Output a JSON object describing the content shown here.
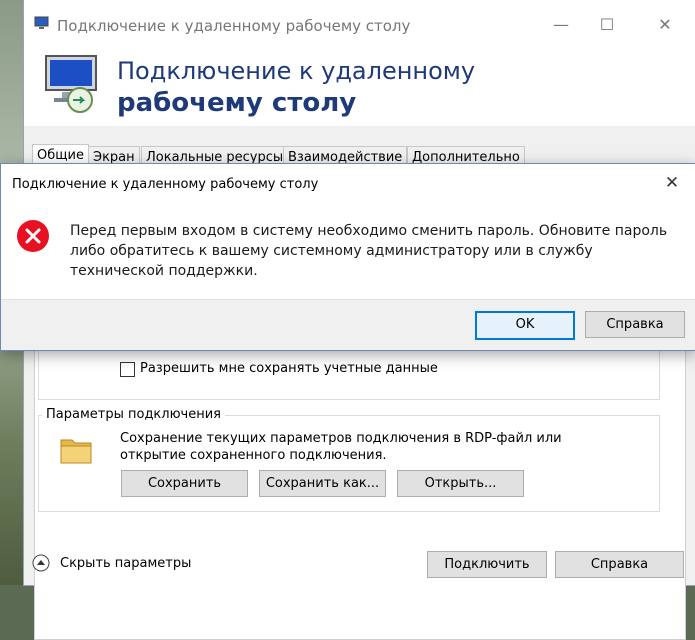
{
  "window": {
    "title": "Подключение к удаленному рабочему столу",
    "banner_line1": "Подключение к удаленному",
    "banner_line2": "рабочему столу"
  },
  "tabs": [
    {
      "label": "Общие",
      "active": true
    },
    {
      "label": "Экран"
    },
    {
      "label": "Локальные ресурсы"
    },
    {
      "label": "Взаимодействие"
    },
    {
      "label": "Дополнительно"
    }
  ],
  "general": {
    "save_credentials_label": "Разрешить мне сохранять учетные данные",
    "save_credentials_checked": false,
    "connection_group_title": "Параметры подключения",
    "connection_description": "Сохранение текущих параметров подключения в RDP-файл или открытие сохраненного подключения.",
    "save_button": "Сохранить",
    "save_as_button": "Сохранить как...",
    "open_button": "Открыть..."
  },
  "footer": {
    "hide_options_label": "Скрыть параметры",
    "connect_button": "Подключить",
    "help_button": "Справка"
  },
  "dialog": {
    "title": "Подключение к удаленному рабочему столу",
    "message": "Перед первым входом в систему необходимо сменить пароль. Обновите пароль либо обратитесь к вашему системному администратору или в службу технической поддержки.",
    "ok_button": "OK",
    "help_button": "Справка",
    "icon": "error-icon"
  },
  "colors": {
    "accent": "#0078d7",
    "banner_text": "#1e3a78",
    "error_red": "#e81123"
  }
}
